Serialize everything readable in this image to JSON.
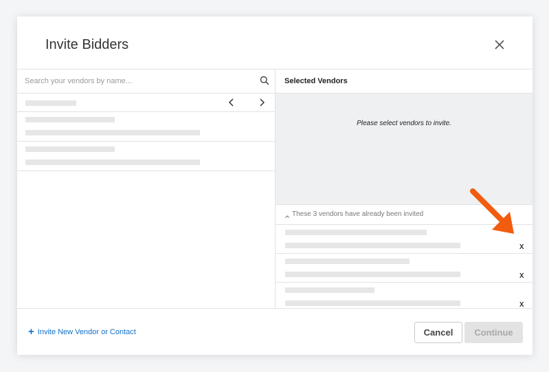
{
  "dialog": {
    "title": "Invite Bidders",
    "close_icon": "close-icon"
  },
  "search": {
    "placeholder": "Search your vendors by name...",
    "icon": "search-icon"
  },
  "pager": {
    "prev_icon": "chevron-left-icon",
    "next_icon": "chevron-right-icon"
  },
  "selected": {
    "header": "Selected Vendors",
    "empty_message": "Please select vendors to invite."
  },
  "invited": {
    "header": "These 3 vendors have already been invited",
    "remove_label": "x",
    "count": 3
  },
  "footer": {
    "invite_new_label": "Invite New Vendor or Contact",
    "cancel_label": "Cancel",
    "continue_label": "Continue"
  },
  "colors": {
    "link": "#1170c9",
    "annotation_arrow": "#f25c0f",
    "skeleton": "#e6e6e6",
    "panel_bg": "#eef0f1"
  }
}
